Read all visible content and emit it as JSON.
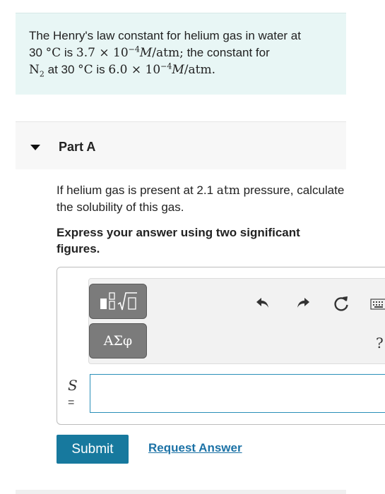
{
  "intro": {
    "t1": "The Henry's law constant for helium gas in water at",
    "t2": "30",
    "t3": "°C",
    "t4": "is",
    "t5": "3.7 × 10",
    "t6": "−4",
    "t7": "M",
    "t8": "/atm;",
    "t9": "the constant for",
    "t10": "N",
    "t11": "2",
    "t12": "at 30",
    "t13": "°C",
    "t14": "is",
    "t15": "6.0 × 10",
    "t16": "−4",
    "t17": "M",
    "t18": "/atm."
  },
  "part": {
    "title": "Part A"
  },
  "question": {
    "q1": "If helium gas is present at 2.1",
    "q2": "atm",
    "q3": "pressure, calculate the solubility of this gas."
  },
  "instruction": "Express your answer using two significant figures.",
  "toolbar": {
    "templates_icon": "templates-icon",
    "greek_label": "ΑΣφ",
    "undo_icon": "undo-icon",
    "redo_icon": "redo-icon",
    "reset_icon": "reset-icon",
    "keyboard_icon": "keyboard-icon",
    "help_label": "?"
  },
  "answer": {
    "variable": "S",
    "equals": "=",
    "value": "",
    "placeholder": ""
  },
  "buttons": {
    "submit": "Submit",
    "request": "Request Answer"
  },
  "colors": {
    "intro_bg": "#e8f6f5",
    "submit_bg": "#17799e",
    "link": "#1c72a6",
    "input_border": "#2a8fb8"
  }
}
